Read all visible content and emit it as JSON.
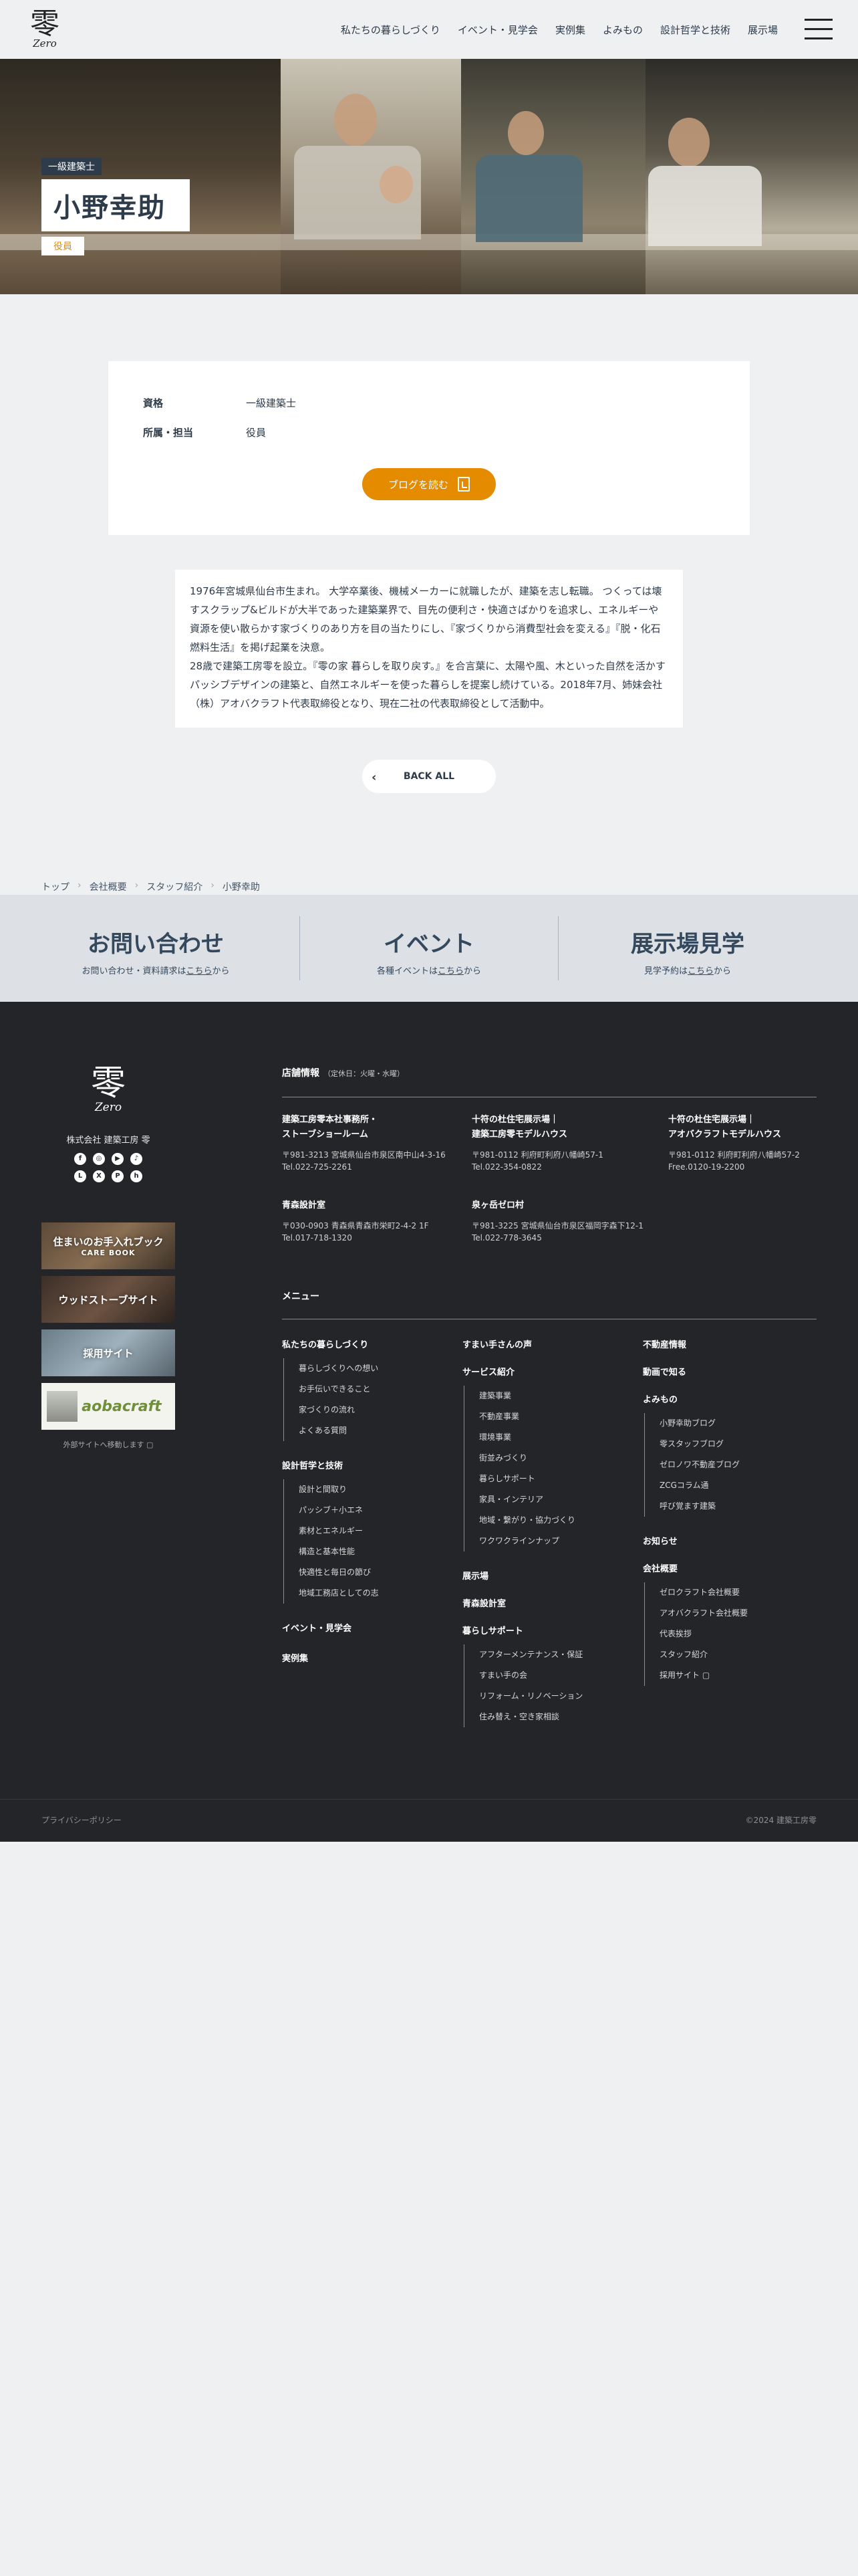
{
  "header": {
    "logo_kanji": "零",
    "logo_en": "Zero",
    "nav": [
      "私たちの暮らしづくり",
      "イベント・見学会",
      "実例集",
      "よみもの",
      "設計哲学と技術",
      "展示場"
    ]
  },
  "hero": {
    "certification": "一級建築士",
    "name": "小野幸助",
    "role": "役員"
  },
  "profile": {
    "rows": [
      {
        "label": "資格",
        "value": "一級建築士"
      },
      {
        "label": "所属・担当",
        "value": "役員"
      }
    ],
    "blog_button": "ブログを読む"
  },
  "bio": {
    "paragraphs": [
      "1976年宮城県仙台市生まれ。 大学卒業後、機械メーカーに就職したが、建築を志し転職。 つくっては壊すスクラップ&ビルドが大半であった建築業界で、目先の便利さ・快適さばかりを追求し、エネルギーや資源を使い散らかす家づくりのあり方を目の当たりにし、『家づくりから消費型社会を変える』『脱・化石燃料生活』を掲げ起業を決意。",
      "28歳で建築工房零を設立。『零の家 暮らしを取り戻す。』を合言葉に、太陽や風、木といった自然を活かすパッシブデザインの建築と、自然エネルギーを使った暮らしを提案し続けている。2018年7月、姉妹会社（株）アオバクラフト代表取締役となり、現在二社の代表取締役として活動中。"
    ]
  },
  "back_button": "BACK ALL",
  "breadcrumb": [
    "トップ",
    "会社概要",
    "スタッフ紹介",
    "小野幸助"
  ],
  "cta": [
    {
      "title": "お問い合わせ",
      "sub_pre": "お問い合わせ・資料請求は",
      "sub_link": "こちら",
      "sub_post": "から"
    },
    {
      "title": "イベント",
      "sub_pre": "各種イベントは",
      "sub_link": "こちら",
      "sub_post": "から"
    },
    {
      "title": "展示場見学",
      "sub_pre": "見学予約は",
      "sub_link": "こちら",
      "sub_post": "から"
    }
  ],
  "footer": {
    "logo_kanji": "零",
    "logo_en": "Zero",
    "company": "株式会社 建築工房 零",
    "banners": [
      {
        "title": "住まいのお手入れブック",
        "sub": "CARE BOOK"
      },
      {
        "title": "ウッドストーブサイト",
        "sub": ""
      },
      {
        "title": "採用サイト",
        "sub": ""
      },
      {
        "title": "aobacraft",
        "sub": ""
      }
    ],
    "external_note": "外部サイトへ移動します ▢",
    "shop_title": "店舗情報",
    "shop_note": "（定休日：火曜・水曜）",
    "shops": [
      {
        "name": "建築工房零本社事務所・\nストーブショールーム",
        "address": "〒981-3213 宮城県仙台市泉区南中山4-3-16",
        "tel": "Tel.022-725-2261"
      },
      {
        "name": "十符の杜住宅展示場｜\n建築工房零モデルハウス",
        "address": "〒981-0112 利府町利府八幡崎57-1",
        "tel": "Tel.022-354-0822"
      },
      {
        "name": "十符の杜住宅展示場｜\nアオバクラフトモデルハウス",
        "address": "〒981-0112 利府町利府八幡崎57-2",
        "tel": "Free.0120-19-2200"
      },
      {
        "name": "青森設計室",
        "address": "〒030-0903 青森県青森市栄町2-4-2 1F",
        "tel": "Tel.017-718-1320"
      },
      {
        "name": "泉ヶ岳ゼロ村",
        "address": "〒981-3225 宮城県仙台市泉区福岡字森下12-1",
        "tel": "Tel.022-778-3645"
      }
    ],
    "menu_title": "メニュー",
    "menu": {
      "col1": [
        {
          "h": "私たちの暮らしづくり",
          "items": [
            "暮らしづくりへの想い",
            "お手伝いできること",
            "家づくりの流れ",
            "よくある質問"
          ]
        },
        {
          "h": "設計哲学と技術",
          "items": [
            "設計と間取り",
            "パッシブ＋小エネ",
            "素材とエネルギー",
            "構造と基本性能",
            "快適性と毎日の節び",
            "地域工務店としての志"
          ]
        },
        {
          "h": "イベント・見学会",
          "items": []
        },
        {
          "h": "実例集",
          "items": []
        }
      ],
      "col2": [
        {
          "h": "すまい手さんの声",
          "items": []
        },
        {
          "h": "サービス紹介",
          "items": [
            "建築事業",
            "不動産事業",
            "環境事業",
            "街並みづくり",
            "暮らしサポート",
            "家具・インテリア",
            "地域・繋がり・協力づくり",
            "ワクワクラインナップ"
          ]
        },
        {
          "h": "展示場",
          "items": []
        },
        {
          "h": "青森設計室",
          "items": []
        },
        {
          "h": "暮らしサポート",
          "items": [
            "アフターメンテナンス・保証",
            "すまい手の会",
            "リフォーム・リノベーション",
            "住み替え・空き家相談"
          ]
        }
      ],
      "col3": [
        {
          "h": "不動産情報",
          "items": []
        },
        {
          "h": "動画で知る",
          "items": []
        },
        {
          "h": "よみもの",
          "items": [
            "小野幸助ブログ",
            "零スタッフブログ",
            "ゼロノワ不動産ブログ",
            "ZCGコラム通",
            "呼び覚ます建築"
          ]
        },
        {
          "h": "お知らせ",
          "items": []
        },
        {
          "h": "会社概要",
          "items": [
            "ゼロクラフト会社概要",
            "アオバクラフト会社概要",
            "代表挨拶",
            "スタッフ紹介",
            "採用サイト ▢"
          ]
        }
      ]
    },
    "privacy": "プライバシーポリシー",
    "copyright": "©2024 建築工房零"
  }
}
